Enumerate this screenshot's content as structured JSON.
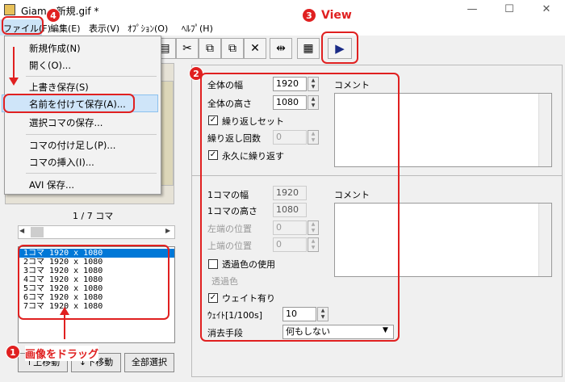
{
  "window": {
    "title": "Giam - 新規.gif *",
    "minimize": "—",
    "maximize": "☐",
    "close": "✕"
  },
  "menubar": [
    {
      "label": "ファイル(F)"
    },
    {
      "label": "編集(E)"
    },
    {
      "label": "表示(V)"
    },
    {
      "label": "ｵﾌﾟｼｮﾝ(O)"
    },
    {
      "label": "ﾍﾙﾌﾟ(H)"
    }
  ],
  "file_menu": {
    "items": [
      {
        "label": "新規作成(N)"
      },
      {
        "label": "開く(O)..."
      },
      {
        "label": "上書き保存(S)"
      },
      {
        "label": "名前を付けて保存(A)..."
      },
      {
        "label": "選択コマの保存..."
      },
      {
        "label": "コマの付け足し(P)..."
      },
      {
        "label": "コマの挿入(I)..."
      },
      {
        "label": "AVI 保存..."
      }
    ],
    "highlighted_index": 3
  },
  "annotations": {
    "badge1": "1",
    "text1": "画像をドラッグ",
    "badge2": "2",
    "badge3": "3",
    "text3": "View",
    "badge4": "4",
    "color": "#e02020"
  },
  "toolbar": {
    "icons": [
      "open-file-icon",
      "cut-icon",
      "copy-frame-icon",
      "paste-frame-icon",
      "delete-icon",
      "fit-icon",
      "grid-icon",
      "play-icon"
    ],
    "cut": "✂",
    "delete": "✕",
    "grid": "▦",
    "play": "▶",
    "fit": "⇹"
  },
  "frame_panel": {
    "counter": "1 / 7 コマ",
    "scroll_left": "◀",
    "scroll_right": "▶"
  },
  "frame_list": [
    "1コマ  1920 x 1080",
    "2コマ  1920 x 1080",
    "3コマ  1920 x 1080",
    "4コマ  1920 x 1080",
    "5コマ  1920 x 1080",
    "6コマ  1920 x 1080",
    "7コマ  1920 x 1080"
  ],
  "frame_buttons": {
    "up": "↑上移動",
    "down": "↓下移動",
    "select_all": "全部選択"
  },
  "global_settings": {
    "width_label": "全体の幅",
    "width_value": "1920",
    "height_label": "全体の高さ",
    "height_value": "1080",
    "repeat_set_label": "繰り返しセット",
    "repeat_count_label": "繰り返し回数",
    "repeat_count_value": "0",
    "forever_label": "永久に繰り返す",
    "comment_label": "コメント"
  },
  "frame_settings": {
    "width_label": "1コマの幅",
    "width_value": "1920",
    "height_label": "1コマの高さ",
    "height_value": "1080",
    "left_label": "左端の位置",
    "left_value": "0",
    "top_label": "上端の位置",
    "top_value": "0",
    "transparent_label": "透過色の使用",
    "transparent_color_label": "透過色",
    "wait_label": "ウェイト有り",
    "wait_unit_label": "ｳｪｲﾄ[1/100s]",
    "wait_value": "10",
    "dispose_label": "消去手段",
    "dispose_value": "何もしない",
    "comment_label": "コメント"
  }
}
